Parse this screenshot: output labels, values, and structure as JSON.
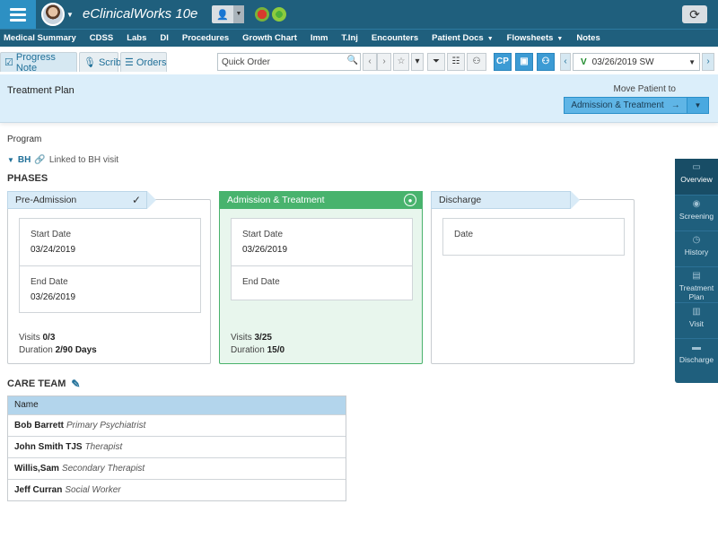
{
  "app": {
    "title": "eClinicalWorks 10e"
  },
  "nav": [
    {
      "label": "Medical Summary",
      "dropdown": false
    },
    {
      "label": "CDSS",
      "dropdown": false
    },
    {
      "label": "Labs",
      "dropdown": false
    },
    {
      "label": "DI",
      "dropdown": false
    },
    {
      "label": "Procedures",
      "dropdown": false
    },
    {
      "label": "Growth Chart",
      "dropdown": false
    },
    {
      "label": "Imm",
      "dropdown": false
    },
    {
      "label": "T.Inj",
      "dropdown": false
    },
    {
      "label": "Encounters",
      "dropdown": false
    },
    {
      "label": "Patient Docs",
      "dropdown": true
    },
    {
      "label": "Flowsheets",
      "dropdown": true
    },
    {
      "label": "Notes",
      "dropdown": false
    }
  ],
  "tabs": {
    "progress_note": "Progress Note",
    "scribe": "Scribe",
    "orders": "Orders"
  },
  "toolbar": {
    "quick_order_placeholder": "Quick Order",
    "cp": "CP",
    "visit": {
      "letter": "V",
      "date": "03/26/2019 SW"
    }
  },
  "header": {
    "title": "Treatment Plan",
    "move_label": "Move Patient to",
    "move_button": "Admission & Treatment"
  },
  "program": {
    "label": "Program",
    "code": "BH",
    "linked_text": "Linked to BH visit",
    "phases_label": "PHASES"
  },
  "phases": [
    {
      "name": "Pre-Admission",
      "completed": true,
      "start_label": "Start Date",
      "start_date": "03/24/2019",
      "end_label": "End Date",
      "end_date": "03/26/2019",
      "visits_label": "Visits",
      "visits": "0/3",
      "duration_label": "Duration",
      "duration": "2/90 Days"
    },
    {
      "name": "Admission & Treatment",
      "current": true,
      "start_label": "Start Date",
      "start_date": "03/26/2019",
      "end_label": "End Date",
      "end_date": "",
      "visits_label": "Visits",
      "visits": "3/25",
      "duration_label": "Duration",
      "duration": "15/0"
    },
    {
      "name": "Discharge",
      "date_label": "Date"
    }
  ],
  "care_team": {
    "title": "CARE TEAM",
    "column": "Name",
    "members": [
      {
        "name": "Bob Barrett",
        "role": "Primary Psychiatrist"
      },
      {
        "name": "John Smith TJS",
        "role": "Therapist"
      },
      {
        "name": "Willis,Sam",
        "role": "Secondary Therapist"
      },
      {
        "name": "Jeff Curran",
        "role": "Social Worker"
      }
    ]
  },
  "side_panel": [
    {
      "label": "Overview",
      "icon": "monitor-icon"
    },
    {
      "label": "Screening",
      "icon": "eye-icon"
    },
    {
      "label": "History",
      "icon": "clock-icon"
    },
    {
      "label": "Treatment Plan",
      "icon": "document-icon"
    },
    {
      "label": "Visit",
      "icon": "visit-icon"
    },
    {
      "label": "Discharge",
      "icon": "bed-icon"
    }
  ]
}
